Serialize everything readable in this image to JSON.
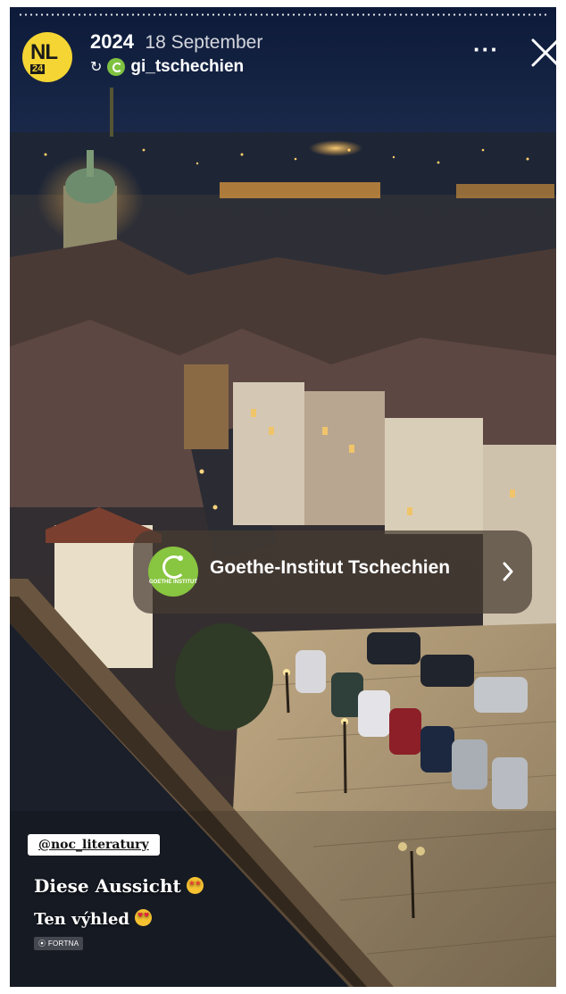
{
  "header": {
    "avatar_text": "NL",
    "avatar_number": "24",
    "year": "2024",
    "date": "18 September",
    "repost_icon": "repost-icon",
    "account_handle": "gi_tschechien",
    "more_icon": "more-dots-icon",
    "close_icon": "close-icon"
  },
  "link_sticker": {
    "logo_text": "GOETHE INSTITUT",
    "label": "Goethe-Institut Tschechien",
    "chevron_icon": "chevron-right-icon"
  },
  "stickers": {
    "mention": "@noc_literatury",
    "caption_1": "Diese Aussicht",
    "caption_1_emoji": "star-struck-emoji",
    "caption_2": "Ten výhled",
    "caption_2_emoji": "heart-eyes-emoji",
    "location_icon": "location-pin-icon",
    "location": "FORTNA"
  },
  "colors": {
    "avatar_bg": "#f4d533",
    "goethe_green": "#88c540",
    "sticker_bg": "#463c32"
  }
}
